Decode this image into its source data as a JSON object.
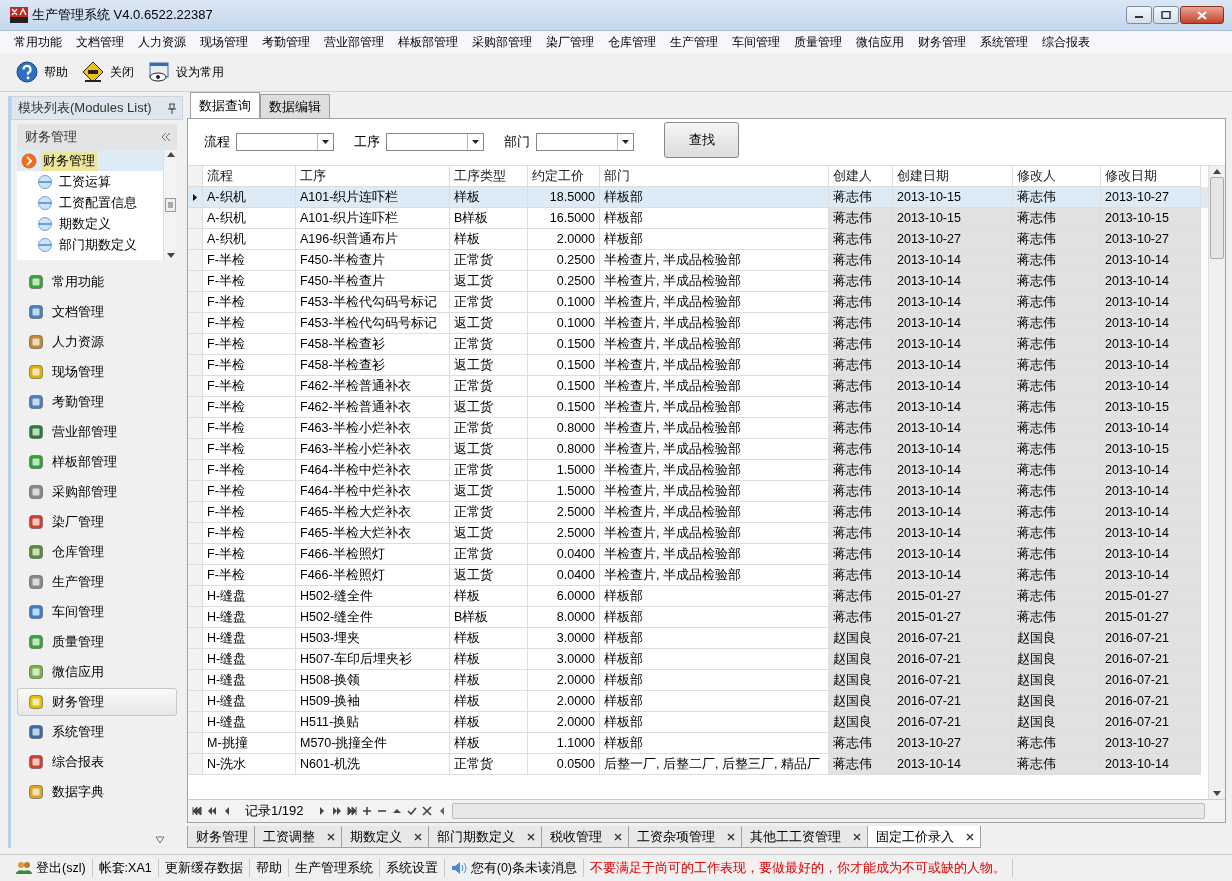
{
  "window": {
    "title": "生产管理系统 V4.0.6522.22387"
  },
  "menu": [
    "常用功能",
    "文档管理",
    "人力资源",
    "现场管理",
    "考勤管理",
    "营业部管理",
    "样板部管理",
    "采购部管理",
    "染厂管理",
    "仓库管理",
    "生产管理",
    "车间管理",
    "质量管理",
    "微信应用",
    "财务管理",
    "系统管理",
    "综合报表"
  ],
  "toolbar": [
    {
      "label": "帮助",
      "kind": "help"
    },
    {
      "label": "关闭",
      "kind": "exit"
    },
    {
      "label": "设为常用",
      "kind": "favorite"
    }
  ],
  "sidebar": {
    "title": "模块列表(Modules List)",
    "group": "财务管理",
    "tree": [
      {
        "label": "财务管理",
        "selected": true,
        "children": [
          {
            "label": "工资运算",
            "selected": false
          },
          {
            "label": "工资配置信息",
            "selected": false
          },
          {
            "label": "期数定义",
            "selected": false
          },
          {
            "label": "部门期数定义",
            "selected": false
          }
        ]
      }
    ],
    "items": [
      {
        "label": "常用功能",
        "selected": false
      },
      {
        "label": "文档管理",
        "selected": false
      },
      {
        "label": "人力资源",
        "selected": false
      },
      {
        "label": "现场管理",
        "selected": false
      },
      {
        "label": "考勤管理",
        "selected": false
      },
      {
        "label": "营业部管理",
        "selected": false
      },
      {
        "label": "样板部管理",
        "selected": false
      },
      {
        "label": "采购部管理",
        "selected": false
      },
      {
        "label": "染厂管理",
        "selected": false
      },
      {
        "label": "仓库管理",
        "selected": false
      },
      {
        "label": "生产管理",
        "selected": false
      },
      {
        "label": "车间管理",
        "selected": false
      },
      {
        "label": "质量管理",
        "selected": false
      },
      {
        "label": "微信应用",
        "selected": false
      },
      {
        "label": "财务管理",
        "selected": true
      },
      {
        "label": "系统管理",
        "selected": false
      },
      {
        "label": "综合报表",
        "selected": false
      },
      {
        "label": "数据字典",
        "selected": false
      }
    ]
  },
  "tabs": [
    {
      "label": "数据查询",
      "selected": true
    },
    {
      "label": "数据编辑",
      "selected": false
    }
  ],
  "filters": [
    {
      "label": "流程"
    },
    {
      "label": "工序"
    },
    {
      "label": "部门"
    }
  ],
  "search_button": "查找",
  "table": {
    "columns": [
      "流程",
      "工序",
      "工序类型",
      "约定工价",
      "部门",
      "创建人",
      "创建日期",
      "修改人",
      "修改日期"
    ],
    "rows": [
      {
        "selected": true,
        "cells": [
          "A-织机",
          "A101-织片连吓栏",
          "样板",
          "18.5000",
          "样板部",
          "蒋志伟",
          "2013-10-15",
          "蒋志伟",
          "2013-10-27"
        ]
      },
      {
        "selected": false,
        "cells": [
          "A-织机",
          "A101-织片连吓栏",
          "B样板",
          "16.5000",
          "样板部",
          "蒋志伟",
          "2013-10-15",
          "蒋志伟",
          "2013-10-15"
        ]
      },
      {
        "selected": false,
        "cells": [
          "A-织机",
          "A196-织普通布片",
          "样板",
          "2.0000",
          "样板部",
          "蒋志伟",
          "2013-10-27",
          "蒋志伟",
          "2013-10-27"
        ]
      },
      {
        "selected": false,
        "cells": [
          "F-半检",
          "F450-半检查片",
          "正常货",
          "0.2500",
          "半检查片, 半成品检验部",
          "蒋志伟",
          "2013-10-14",
          "蒋志伟",
          "2013-10-14"
        ]
      },
      {
        "selected": false,
        "cells": [
          "F-半检",
          "F450-半检查片",
          "返工货",
          "0.2500",
          "半检查片, 半成品检验部",
          "蒋志伟",
          "2013-10-14",
          "蒋志伟",
          "2013-10-14"
        ]
      },
      {
        "selected": false,
        "cells": [
          "F-半检",
          "F453-半检代勾码号标记",
          "正常货",
          "0.1000",
          "半检查片, 半成品检验部",
          "蒋志伟",
          "2013-10-14",
          "蒋志伟",
          "2013-10-14"
        ]
      },
      {
        "selected": false,
        "cells": [
          "F-半检",
          "F453-半检代勾码号标记",
          "返工货",
          "0.1000",
          "半检查片, 半成品检验部",
          "蒋志伟",
          "2013-10-14",
          "蒋志伟",
          "2013-10-14"
        ]
      },
      {
        "selected": false,
        "cells": [
          "F-半检",
          "F458-半检查衫",
          "正常货",
          "0.1500",
          "半检查片, 半成品检验部",
          "蒋志伟",
          "2013-10-14",
          "蒋志伟",
          "2013-10-14"
        ]
      },
      {
        "selected": false,
        "cells": [
          "F-半检",
          "F458-半检查衫",
          "返工货",
          "0.1500",
          "半检查片, 半成品检验部",
          "蒋志伟",
          "2013-10-14",
          "蒋志伟",
          "2013-10-14"
        ]
      },
      {
        "selected": false,
        "cells": [
          "F-半检",
          "F462-半检普通补衣",
          "正常货",
          "0.1500",
          "半检查片, 半成品检验部",
          "蒋志伟",
          "2013-10-14",
          "蒋志伟",
          "2013-10-14"
        ]
      },
      {
        "selected": false,
        "cells": [
          "F-半检",
          "F462-半检普通补衣",
          "返工货",
          "0.1500",
          "半检查片, 半成品检验部",
          "蒋志伟",
          "2013-10-14",
          "蒋志伟",
          "2013-10-15"
        ]
      },
      {
        "selected": false,
        "cells": [
          "F-半检",
          "F463-半检小烂补衣",
          "正常货",
          "0.8000",
          "半检查片, 半成品检验部",
          "蒋志伟",
          "2013-10-14",
          "蒋志伟",
          "2013-10-14"
        ]
      },
      {
        "selected": false,
        "cells": [
          "F-半检",
          "F463-半检小烂补衣",
          "返工货",
          "0.8000",
          "半检查片, 半成品检验部",
          "蒋志伟",
          "2013-10-14",
          "蒋志伟",
          "2013-10-15"
        ]
      },
      {
        "selected": false,
        "cells": [
          "F-半检",
          "F464-半检中烂补衣",
          "正常货",
          "1.5000",
          "半检查片, 半成品检验部",
          "蒋志伟",
          "2013-10-14",
          "蒋志伟",
          "2013-10-14"
        ]
      },
      {
        "selected": false,
        "cells": [
          "F-半检",
          "F464-半检中烂补衣",
          "返工货",
          "1.5000",
          "半检查片, 半成品检验部",
          "蒋志伟",
          "2013-10-14",
          "蒋志伟",
          "2013-10-14"
        ]
      },
      {
        "selected": false,
        "cells": [
          "F-半检",
          "F465-半检大烂补衣",
          "正常货",
          "2.5000",
          "半检查片, 半成品检验部",
          "蒋志伟",
          "2013-10-14",
          "蒋志伟",
          "2013-10-14"
        ]
      },
      {
        "selected": false,
        "cells": [
          "F-半检",
          "F465-半检大烂补衣",
          "返工货",
          "2.5000",
          "半检查片, 半成品检验部",
          "蒋志伟",
          "2013-10-14",
          "蒋志伟",
          "2013-10-14"
        ]
      },
      {
        "selected": false,
        "cells": [
          "F-半检",
          "F466-半检照灯",
          "正常货",
          "0.0400",
          "半检查片, 半成品检验部",
          "蒋志伟",
          "2013-10-14",
          "蒋志伟",
          "2013-10-14"
        ]
      },
      {
        "selected": false,
        "cells": [
          "F-半检",
          "F466-半检照灯",
          "返工货",
          "0.0400",
          "半检查片, 半成品检验部",
          "蒋志伟",
          "2013-10-14",
          "蒋志伟",
          "2013-10-14"
        ]
      },
      {
        "selected": false,
        "cells": [
          "H-缝盘",
          "H502-缝全件",
          "样板",
          "6.0000",
          "样板部",
          "蒋志伟",
          "2015-01-27",
          "蒋志伟",
          "2015-01-27"
        ]
      },
      {
        "selected": false,
        "cells": [
          "H-缝盘",
          "H502-缝全件",
          "B样板",
          "8.0000",
          "样板部",
          "蒋志伟",
          "2015-01-27",
          "蒋志伟",
          "2015-01-27"
        ]
      },
      {
        "selected": false,
        "cells": [
          "H-缝盘",
          "H503-埋夹",
          "样板",
          "3.0000",
          "样板部",
          "赵国良",
          "2016-07-21",
          "赵国良",
          "2016-07-21"
        ]
      },
      {
        "selected": false,
        "cells": [
          "H-缝盘",
          "H507-车印后埋夹衫",
          "样板",
          "3.0000",
          "样板部",
          "赵国良",
          "2016-07-21",
          "赵国良",
          "2016-07-21"
        ]
      },
      {
        "selected": false,
        "cells": [
          "H-缝盘",
          "H508-换领",
          "样板",
          "2.0000",
          "样板部",
          "赵国良",
          "2016-07-21",
          "赵国良",
          "2016-07-21"
        ]
      },
      {
        "selected": false,
        "cells": [
          "H-缝盘",
          "H509-换袖",
          "样板",
          "2.0000",
          "样板部",
          "赵国良",
          "2016-07-21",
          "赵国良",
          "2016-07-21"
        ]
      },
      {
        "selected": false,
        "cells": [
          "H-缝盘",
          "H511-换贴",
          "样板",
          "2.0000",
          "样板部",
          "赵国良",
          "2016-07-21",
          "赵国良",
          "2016-07-21"
        ]
      },
      {
        "selected": false,
        "cells": [
          "M-挑撞",
          "M570-挑撞全件",
          "样板",
          "1.1000",
          "样板部",
          "蒋志伟",
          "2013-10-27",
          "蒋志伟",
          "2013-10-27"
        ]
      },
      {
        "selected": false,
        "cells": [
          "N-洗水",
          "N601-机洗",
          "正常货",
          "0.0500",
          "后整一厂, 后整二厂, 后整三厂, 精品厂",
          "蒋志伟",
          "2013-10-14",
          "蒋志伟",
          "2013-10-14"
        ]
      }
    ]
  },
  "pager": {
    "record": "记录1/192"
  },
  "doc_tabs": [
    {
      "label": "财务管理",
      "selected": false,
      "closable": false
    },
    {
      "label": "工资调整",
      "selected": false,
      "closable": true
    },
    {
      "label": "期数定义",
      "selected": false,
      "closable": true
    },
    {
      "label": "部门期数定义",
      "selected": false,
      "closable": true
    },
    {
      "label": "税收管理",
      "selected": false,
      "closable": true
    },
    {
      "label": "工资杂项管理",
      "selected": false,
      "closable": true
    },
    {
      "label": "其他工工资管理",
      "selected": false,
      "closable": true
    },
    {
      "label": "固定工价录入",
      "selected": true,
      "closable": true
    }
  ],
  "status_bar": [
    {
      "label": "登出(szl)",
      "kind": "user"
    },
    {
      "label": "帐套:XA1",
      "kind": "text"
    },
    {
      "label": "更新缓存数据",
      "kind": "link"
    },
    {
      "label": "帮助",
      "kind": "link"
    },
    {
      "label": "生产管理系统",
      "kind": "link"
    },
    {
      "label": "系统设置",
      "kind": "link"
    },
    {
      "label": "您有(0)条未读消息",
      "kind": "message"
    },
    {
      "label": "不要满足于尚可的工作表现，要做最好的，你才能成为不可或缺的人物。",
      "kind": "notice"
    }
  ]
}
